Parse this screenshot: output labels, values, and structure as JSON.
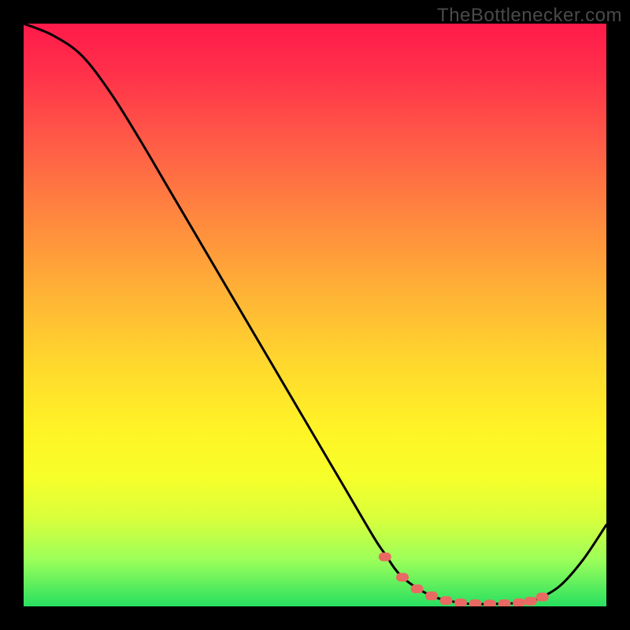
{
  "watermark": "TheBottlenecker.com",
  "chart_data": {
    "type": "line",
    "title": "",
    "xlabel": "",
    "ylabel": "",
    "xlim": [
      0,
      100
    ],
    "ylim": [
      0,
      100
    ],
    "x": [
      0,
      5,
      10,
      15,
      20,
      25,
      30,
      35,
      40,
      45,
      50,
      55,
      60,
      62,
      65,
      70,
      75,
      78,
      80,
      85,
      88,
      92,
      96,
      100
    ],
    "values": [
      100,
      98,
      94.5,
      88,
      80,
      71.5,
      63,
      54.5,
      46,
      37.5,
      29,
      20.5,
      12,
      9,
      5,
      1.8,
      0.6,
      0.4,
      0.4,
      0.6,
      1.2,
      3.5,
      8,
      14
    ],
    "markers": {
      "x": [
        62,
        65,
        67.5,
        70,
        72.5,
        75,
        77.5,
        80,
        82.5,
        85,
        87,
        89
      ],
      "y": [
        8.5,
        5.0,
        3.0,
        1.8,
        1.0,
        0.6,
        0.45,
        0.4,
        0.45,
        0.6,
        0.9,
        1.6
      ]
    },
    "gradient_stops": [
      {
        "pos": 0,
        "color": "#ff1a4a"
      },
      {
        "pos": 8,
        "color": "#ff2f4a"
      },
      {
        "pos": 20,
        "color": "#ff5a47"
      },
      {
        "pos": 34,
        "color": "#ff8a3e"
      },
      {
        "pos": 46,
        "color": "#ffb236"
      },
      {
        "pos": 58,
        "color": "#ffd72e"
      },
      {
        "pos": 70,
        "color": "#fff426"
      },
      {
        "pos": 78,
        "color": "#f6ff2a"
      },
      {
        "pos": 85,
        "color": "#d8ff3c"
      },
      {
        "pos": 92,
        "color": "#9cff5a"
      },
      {
        "pos": 100,
        "color": "#28e060"
      }
    ],
    "curve_color": "#000000",
    "marker_color": "#e96a63"
  }
}
